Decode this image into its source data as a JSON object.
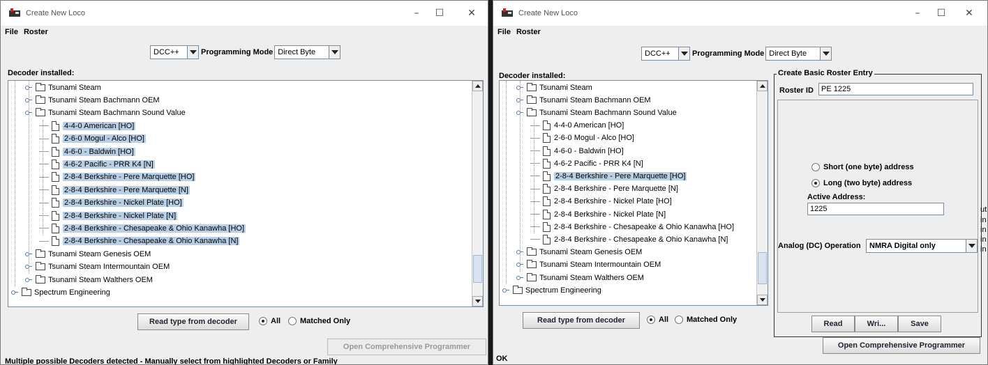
{
  "left": {
    "title": "Create New Loco",
    "menu": [
      "File",
      "Roster"
    ],
    "protocol": "DCC++",
    "prog_mode_label": "Programming Mode",
    "prog_mode_value": "Direct Byte",
    "decoder_label": "Decoder installed:",
    "tree": [
      {
        "label": "Tsunami Steam",
        "level": 1,
        "kind": "folder",
        "selected": false
      },
      {
        "label": "Tsunami Steam Bachmann OEM",
        "level": 1,
        "kind": "folder",
        "selected": false
      },
      {
        "label": "Tsunami Steam Bachmann Sound Value",
        "level": 1,
        "kind": "folder-open",
        "selected": false
      },
      {
        "label": "4-4-0 American [HO]",
        "level": 2,
        "kind": "leaf",
        "selected": true
      },
      {
        "label": "2-6-0 Mogul - Alco [HO]",
        "level": 2,
        "kind": "leaf",
        "selected": true
      },
      {
        "label": "4-6-0 - Baldwin [HO]",
        "level": 2,
        "kind": "leaf",
        "selected": true
      },
      {
        "label": "4-6-2 Pacific - PRR K4 [N]",
        "level": 2,
        "kind": "leaf",
        "selected": true
      },
      {
        "label": "2-8-4 Berkshire - Pere Marquette [HO]",
        "level": 2,
        "kind": "leaf",
        "selected": true
      },
      {
        "label": "2-8-4 Berkshire - Pere Marquette [N]",
        "level": 2,
        "kind": "leaf",
        "selected": true
      },
      {
        "label": "2-8-4 Berkshire - Nickel Plate [HO]",
        "level": 2,
        "kind": "leaf",
        "selected": true
      },
      {
        "label": "2-8-4 Berkshire - Nickel Plate [N]",
        "level": 2,
        "kind": "leaf",
        "selected": true
      },
      {
        "label": "2-8-4 Berkshire - Chesapeake & Ohio Kanawha [HO]",
        "level": 2,
        "kind": "leaf",
        "selected": true
      },
      {
        "label": "2-8-4 Berkshire - Chesapeake & Ohio Kanawha [N]",
        "level": 2,
        "kind": "leaf",
        "selected": true
      },
      {
        "label": "Tsunami Steam Genesis OEM",
        "level": 1,
        "kind": "folder",
        "selected": false
      },
      {
        "label": "Tsunami Steam Intermountain OEM",
        "level": 1,
        "kind": "folder",
        "selected": false
      },
      {
        "label": "Tsunami Steam Walthers OEM",
        "level": 1,
        "kind": "folder",
        "selected": false
      },
      {
        "label": "Spectrum Engineering",
        "level": 0,
        "kind": "folder",
        "selected": false
      }
    ],
    "read_button": "Read type from decoder",
    "radio_all": "All",
    "radio_matched": "Matched Only",
    "open_programmer": "Open Comprehensive Programmer",
    "status": "Multiple possible Decoders detected - Manually select from highlighted Decoders or Family"
  },
  "right": {
    "title": "Create New Loco",
    "menu": [
      "File",
      "Roster"
    ],
    "protocol": "DCC++",
    "prog_mode_label": "Programming Mode",
    "prog_mode_value": "Direct Byte",
    "decoder_label": "Decoder installed:",
    "tree": [
      {
        "label": "Tsunami Steam",
        "level": 1,
        "kind": "folder",
        "selected": false
      },
      {
        "label": "Tsunami Steam Bachmann OEM",
        "level": 1,
        "kind": "folder",
        "selected": false
      },
      {
        "label": "Tsunami Steam Bachmann Sound Value",
        "level": 1,
        "kind": "folder-open",
        "selected": false
      },
      {
        "label": "4-4-0 American [HO]",
        "level": 2,
        "kind": "leaf",
        "selected": false
      },
      {
        "label": "2-6-0 Mogul - Alco [HO]",
        "level": 2,
        "kind": "leaf",
        "selected": false
      },
      {
        "label": "4-6-0 - Baldwin [HO]",
        "level": 2,
        "kind": "leaf",
        "selected": false
      },
      {
        "label": "4-6-2 Pacific - PRR K4 [N]",
        "level": 2,
        "kind": "leaf",
        "selected": false
      },
      {
        "label": "2-8-4 Berkshire - Pere Marquette [HO]",
        "level": 2,
        "kind": "leaf",
        "selected": true
      },
      {
        "label": "2-8-4 Berkshire - Pere Marquette [N]",
        "level": 2,
        "kind": "leaf",
        "selected": false
      },
      {
        "label": "2-8-4 Berkshire - Nickel Plate [HO]",
        "level": 2,
        "kind": "leaf",
        "selected": false
      },
      {
        "label": "2-8-4 Berkshire - Nickel Plate [N]",
        "level": 2,
        "kind": "leaf",
        "selected": false
      },
      {
        "label": "2-8-4 Berkshire - Chesapeake & Ohio Kanawha [HO]",
        "level": 2,
        "kind": "leaf",
        "selected": false
      },
      {
        "label": "2-8-4 Berkshire - Chesapeake & Ohio Kanawha [N]",
        "level": 2,
        "kind": "leaf",
        "selected": false
      },
      {
        "label": "Tsunami Steam Genesis OEM",
        "level": 1,
        "kind": "folder",
        "selected": false
      },
      {
        "label": "Tsunami Steam Intermountain OEM",
        "level": 1,
        "kind": "folder",
        "selected": false
      },
      {
        "label": "Tsunami Steam Walthers OEM",
        "level": 1,
        "kind": "folder",
        "selected": false
      },
      {
        "label": "Spectrum Engineering",
        "level": 0,
        "kind": "folder",
        "selected": false
      }
    ],
    "read_button": "Read type from decoder",
    "radio_all": "All",
    "radio_matched": "Matched Only",
    "roster_panel_title": "Create Basic Roster Entry",
    "roster_id_label": "Roster ID",
    "roster_id_value": "PE 1225",
    "short_address": "Short (one byte) address",
    "long_address": "Long (two byte) address",
    "active_address_label": "Active Address:",
    "active_address_value": "1225",
    "analog_label": "Analog (DC) Operation",
    "analog_value": "NMRA Digital only",
    "read": "Read",
    "write": "Wri...",
    "save": "Save",
    "open_programmer": "Open Comprehensive Programmer",
    "status": "OK"
  },
  "background_edge": [
    "ut",
    "in",
    "in",
    "in",
    "in"
  ]
}
